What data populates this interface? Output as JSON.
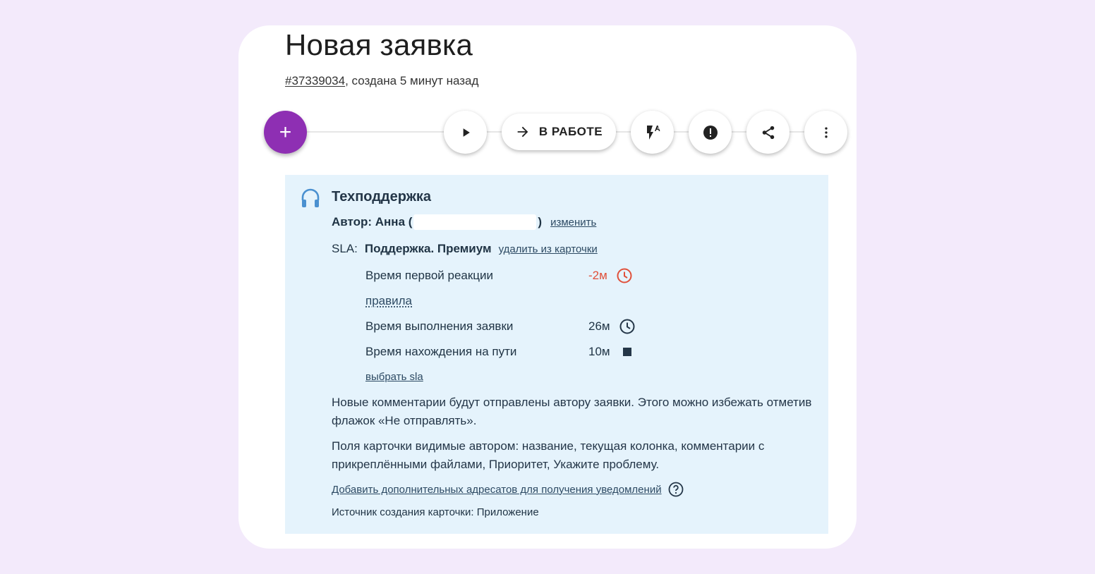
{
  "header": {
    "title": "Новая заявка",
    "ticket_id": "#37339034",
    "created": ", создана 5 минут назад"
  },
  "toolbar": {
    "add_label": "+",
    "status_label": "В РАБОТЕ",
    "icons": [
      "plus-icon",
      "play-icon",
      "arrow-right-icon",
      "flash-off-auto-icon",
      "alert-icon",
      "share-icon",
      "more-vert-icon"
    ]
  },
  "panel": {
    "team": "Техподдержка",
    "author_prefix": "Автор: Анна (",
    "author_suffix": ")",
    "change_link": "изменить",
    "sla_label": "SLA:",
    "sla_name": "Поддержка. Премиум",
    "sla_remove_link": "удалить из карточки",
    "metrics": [
      {
        "label": "Время первой реакции",
        "value": "-2м",
        "icon": "clock-alert-icon"
      },
      {
        "label": "Время выполнения заявки",
        "value": "26м",
        "icon": "clock-icon"
      },
      {
        "label": "Время нахождения на пути",
        "value": "10м",
        "icon": "stop-icon"
      }
    ],
    "rules_link": "правила",
    "choose_sla_link": "выбрать sla",
    "note1": "Новые комментарии будут отправлены автору заявки. Этого можно избежать отметив флажок «Не отправлять».",
    "note2": "Поля карточки видимые автором: название, текущая колонка, комментарии с прикреплёнными файлами, Приоритет, Укажите проблему.",
    "add_recipients_link": "Добавить дополнительных адресатов для получения уведомлений",
    "source": "Источник создания карточки: Приложение"
  },
  "colors": {
    "page_bg": "#f3eafb",
    "panel_bg": "#e5f3fc",
    "fab": "#8e2fb3",
    "overdue": "#e0503a"
  }
}
